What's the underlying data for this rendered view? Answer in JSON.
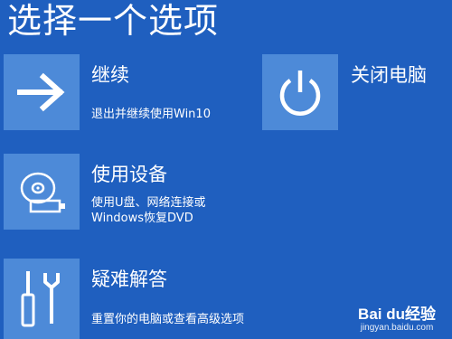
{
  "page": {
    "title": "选择一个选项"
  },
  "options": [
    {
      "title": "继续",
      "description": "退出并继续使用Win10",
      "icon": "arrow-right-icon"
    },
    {
      "title": "使用设备",
      "description_lines": [
        "使用U盘、网络连接或",
        "Windows恢复DVD"
      ],
      "icon": "disk-drive-icon"
    },
    {
      "title": "疑难解答",
      "description": "重置你的电脑或查看高级选项",
      "icon": "tools-icon"
    },
    {
      "title": "关闭电脑",
      "icon": "power-icon"
    }
  ],
  "watermark": {
    "logo": "Bai du经验",
    "url": "jingyan.baidu.com"
  },
  "colors": {
    "background": "#1f5fbf",
    "tile": "#4d8ad8",
    "text": "#ffffff"
  }
}
